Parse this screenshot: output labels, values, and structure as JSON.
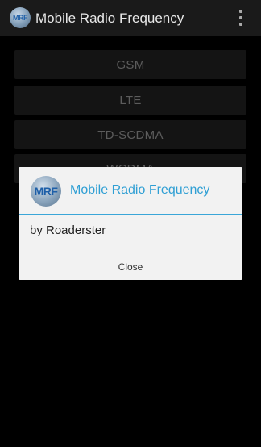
{
  "action_bar": {
    "logo_text": "MRF",
    "title": "Mobile Radio Frequency",
    "overflow_icon": "overflow-menu-icon"
  },
  "buttons": [
    "GSM",
    "LTE",
    "TD-SCDMA",
    "WCDMA"
  ],
  "dialog": {
    "logo_text": "MRF",
    "title": "Mobile Radio Frequency",
    "message": "by Roaderster",
    "close_label": "Close"
  },
  "colors": {
    "accent": "#3aa6d8",
    "action_bar": "#1a1a1a",
    "button_bg": "#262626"
  }
}
